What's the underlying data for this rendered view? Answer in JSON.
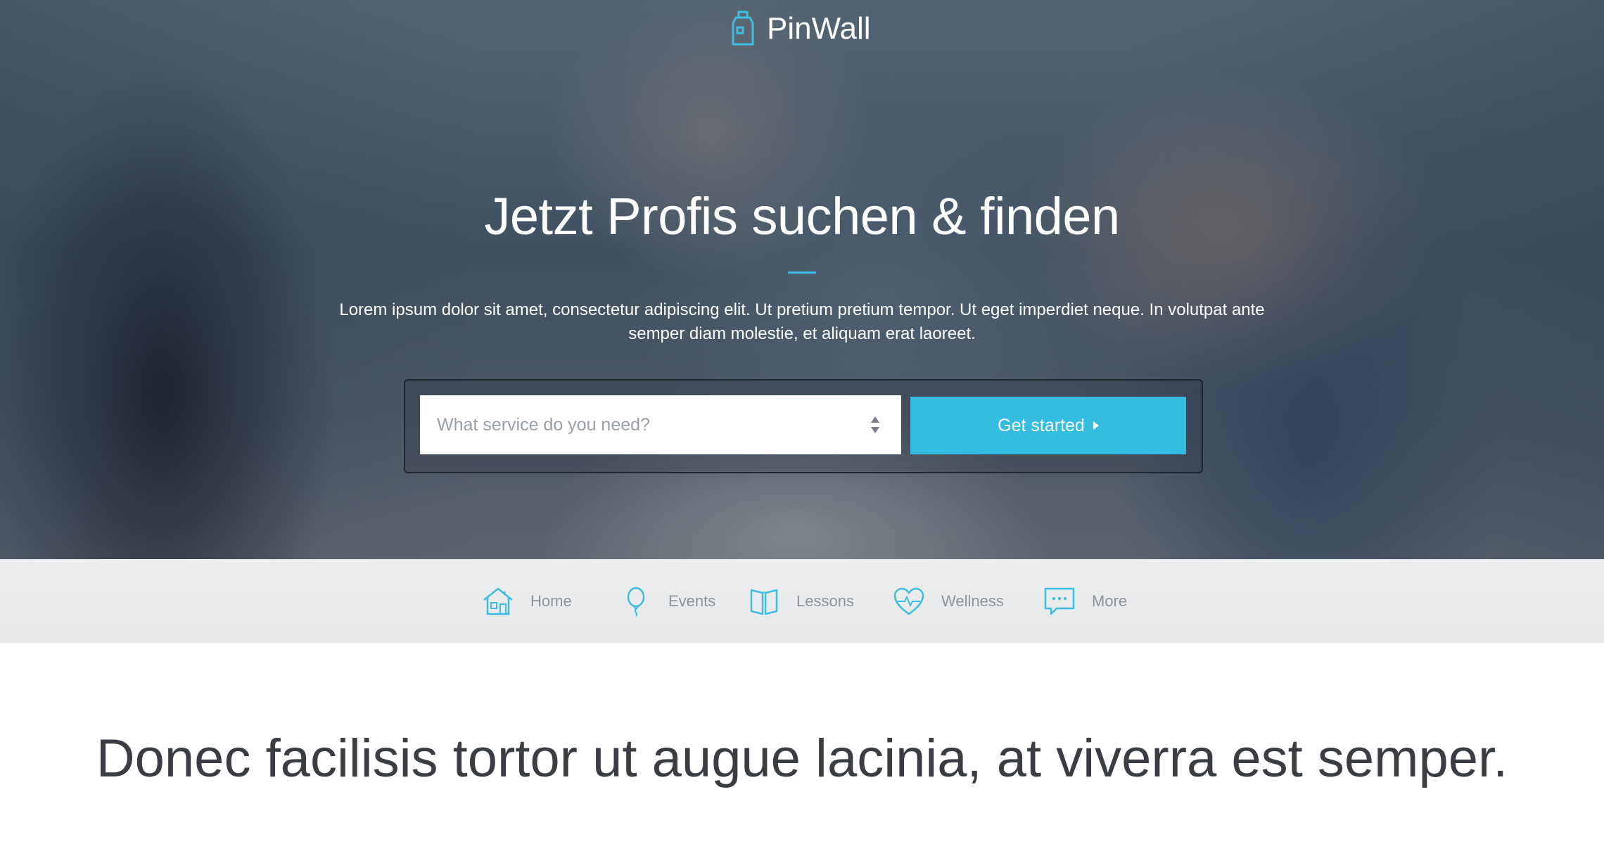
{
  "brand": {
    "name": "PinWall",
    "accent": "#33bbe0"
  },
  "hero": {
    "title": "Jetzt Profis suchen & finden",
    "description": "Lorem ipsum dolor sit amet, consectetur adipiscing elit. Ut pretium pretium tempor. Ut eget imperdiet neque. In volutpat ante semper diam molestie, et aliquam erat laoreet.",
    "search": {
      "placeholder": "What service do you need?"
    },
    "cta_label": "Get started"
  },
  "categories": [
    {
      "label": "Home",
      "icon": "house-icon"
    },
    {
      "label": "Events",
      "icon": "balloon-icon"
    },
    {
      "label": "Lessons",
      "icon": "book-icon"
    },
    {
      "label": "Wellness",
      "icon": "heart-pulse-icon"
    },
    {
      "label": "More",
      "icon": "chat-bubble-icon"
    }
  ],
  "section": {
    "title": "Donec facilisis tortor ut augue lacinia, at viverra est semper."
  }
}
